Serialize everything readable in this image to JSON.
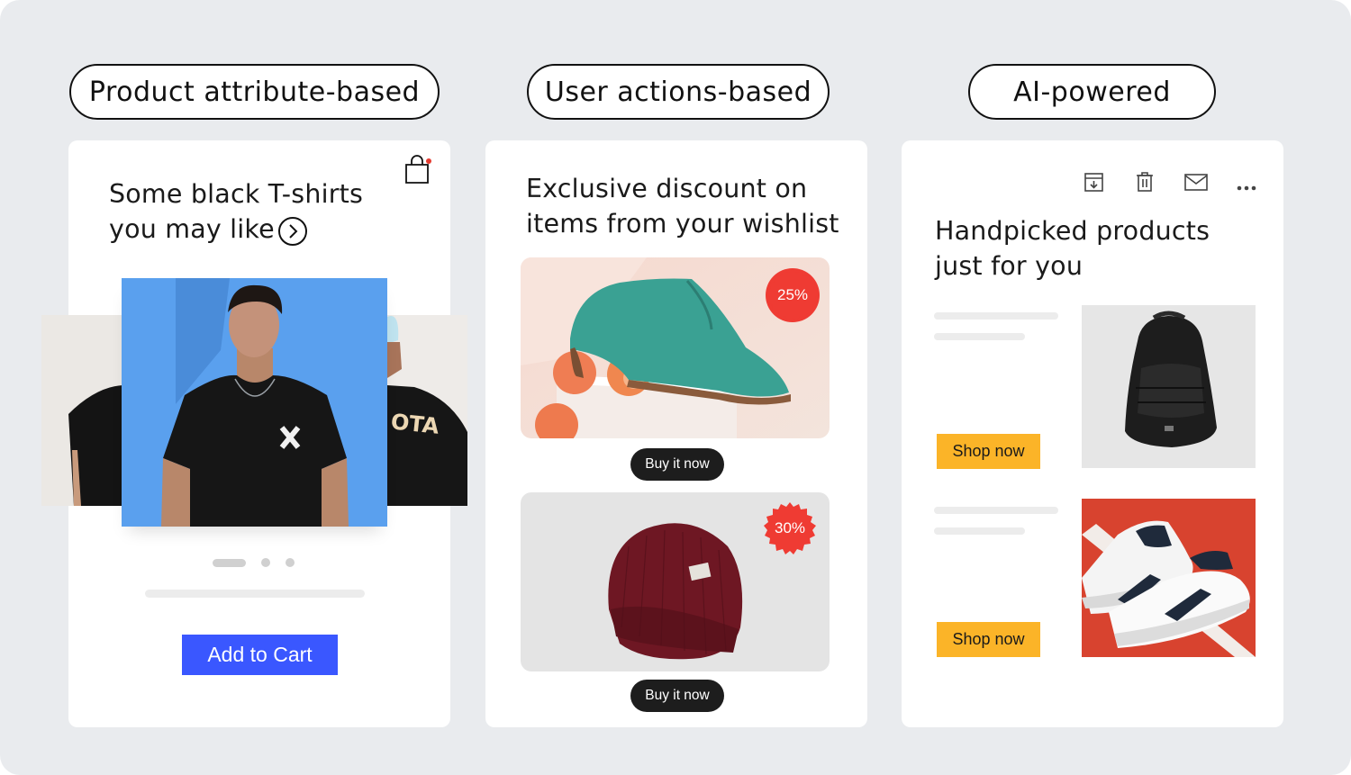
{
  "labels": {
    "product_attribute": "Product attribute-based",
    "user_actions": "User actions-based",
    "ai_powered": "AI-powered"
  },
  "card1": {
    "heading_line1": "Some black T-shirts",
    "heading_line2": "you may like",
    "add_to_cart": "Add to Cart"
  },
  "card2": {
    "heading_line1": "Exclusive discount on",
    "heading_line2": "items from your wishlist",
    "items": [
      {
        "badge": "25%",
        "button": "Buy it now"
      },
      {
        "badge": "30%",
        "button": "Buy it now"
      }
    ]
  },
  "card3": {
    "heading_line1": "Handpicked products",
    "heading_line2": "just for you",
    "items": [
      {
        "button": "Shop now"
      },
      {
        "button": "Shop now"
      }
    ]
  },
  "colors": {
    "background": "#e9ebee",
    "cta_blue": "#3a57ff",
    "shop_yellow": "#fbb428",
    "badge_red": "#ef3b33",
    "dark_button": "#1d1d1d"
  },
  "icons": [
    "shopping-bag-icon",
    "chevron-right-circle-icon",
    "archive-icon",
    "trash-icon",
    "mail-icon",
    "more-dots-icon"
  ]
}
